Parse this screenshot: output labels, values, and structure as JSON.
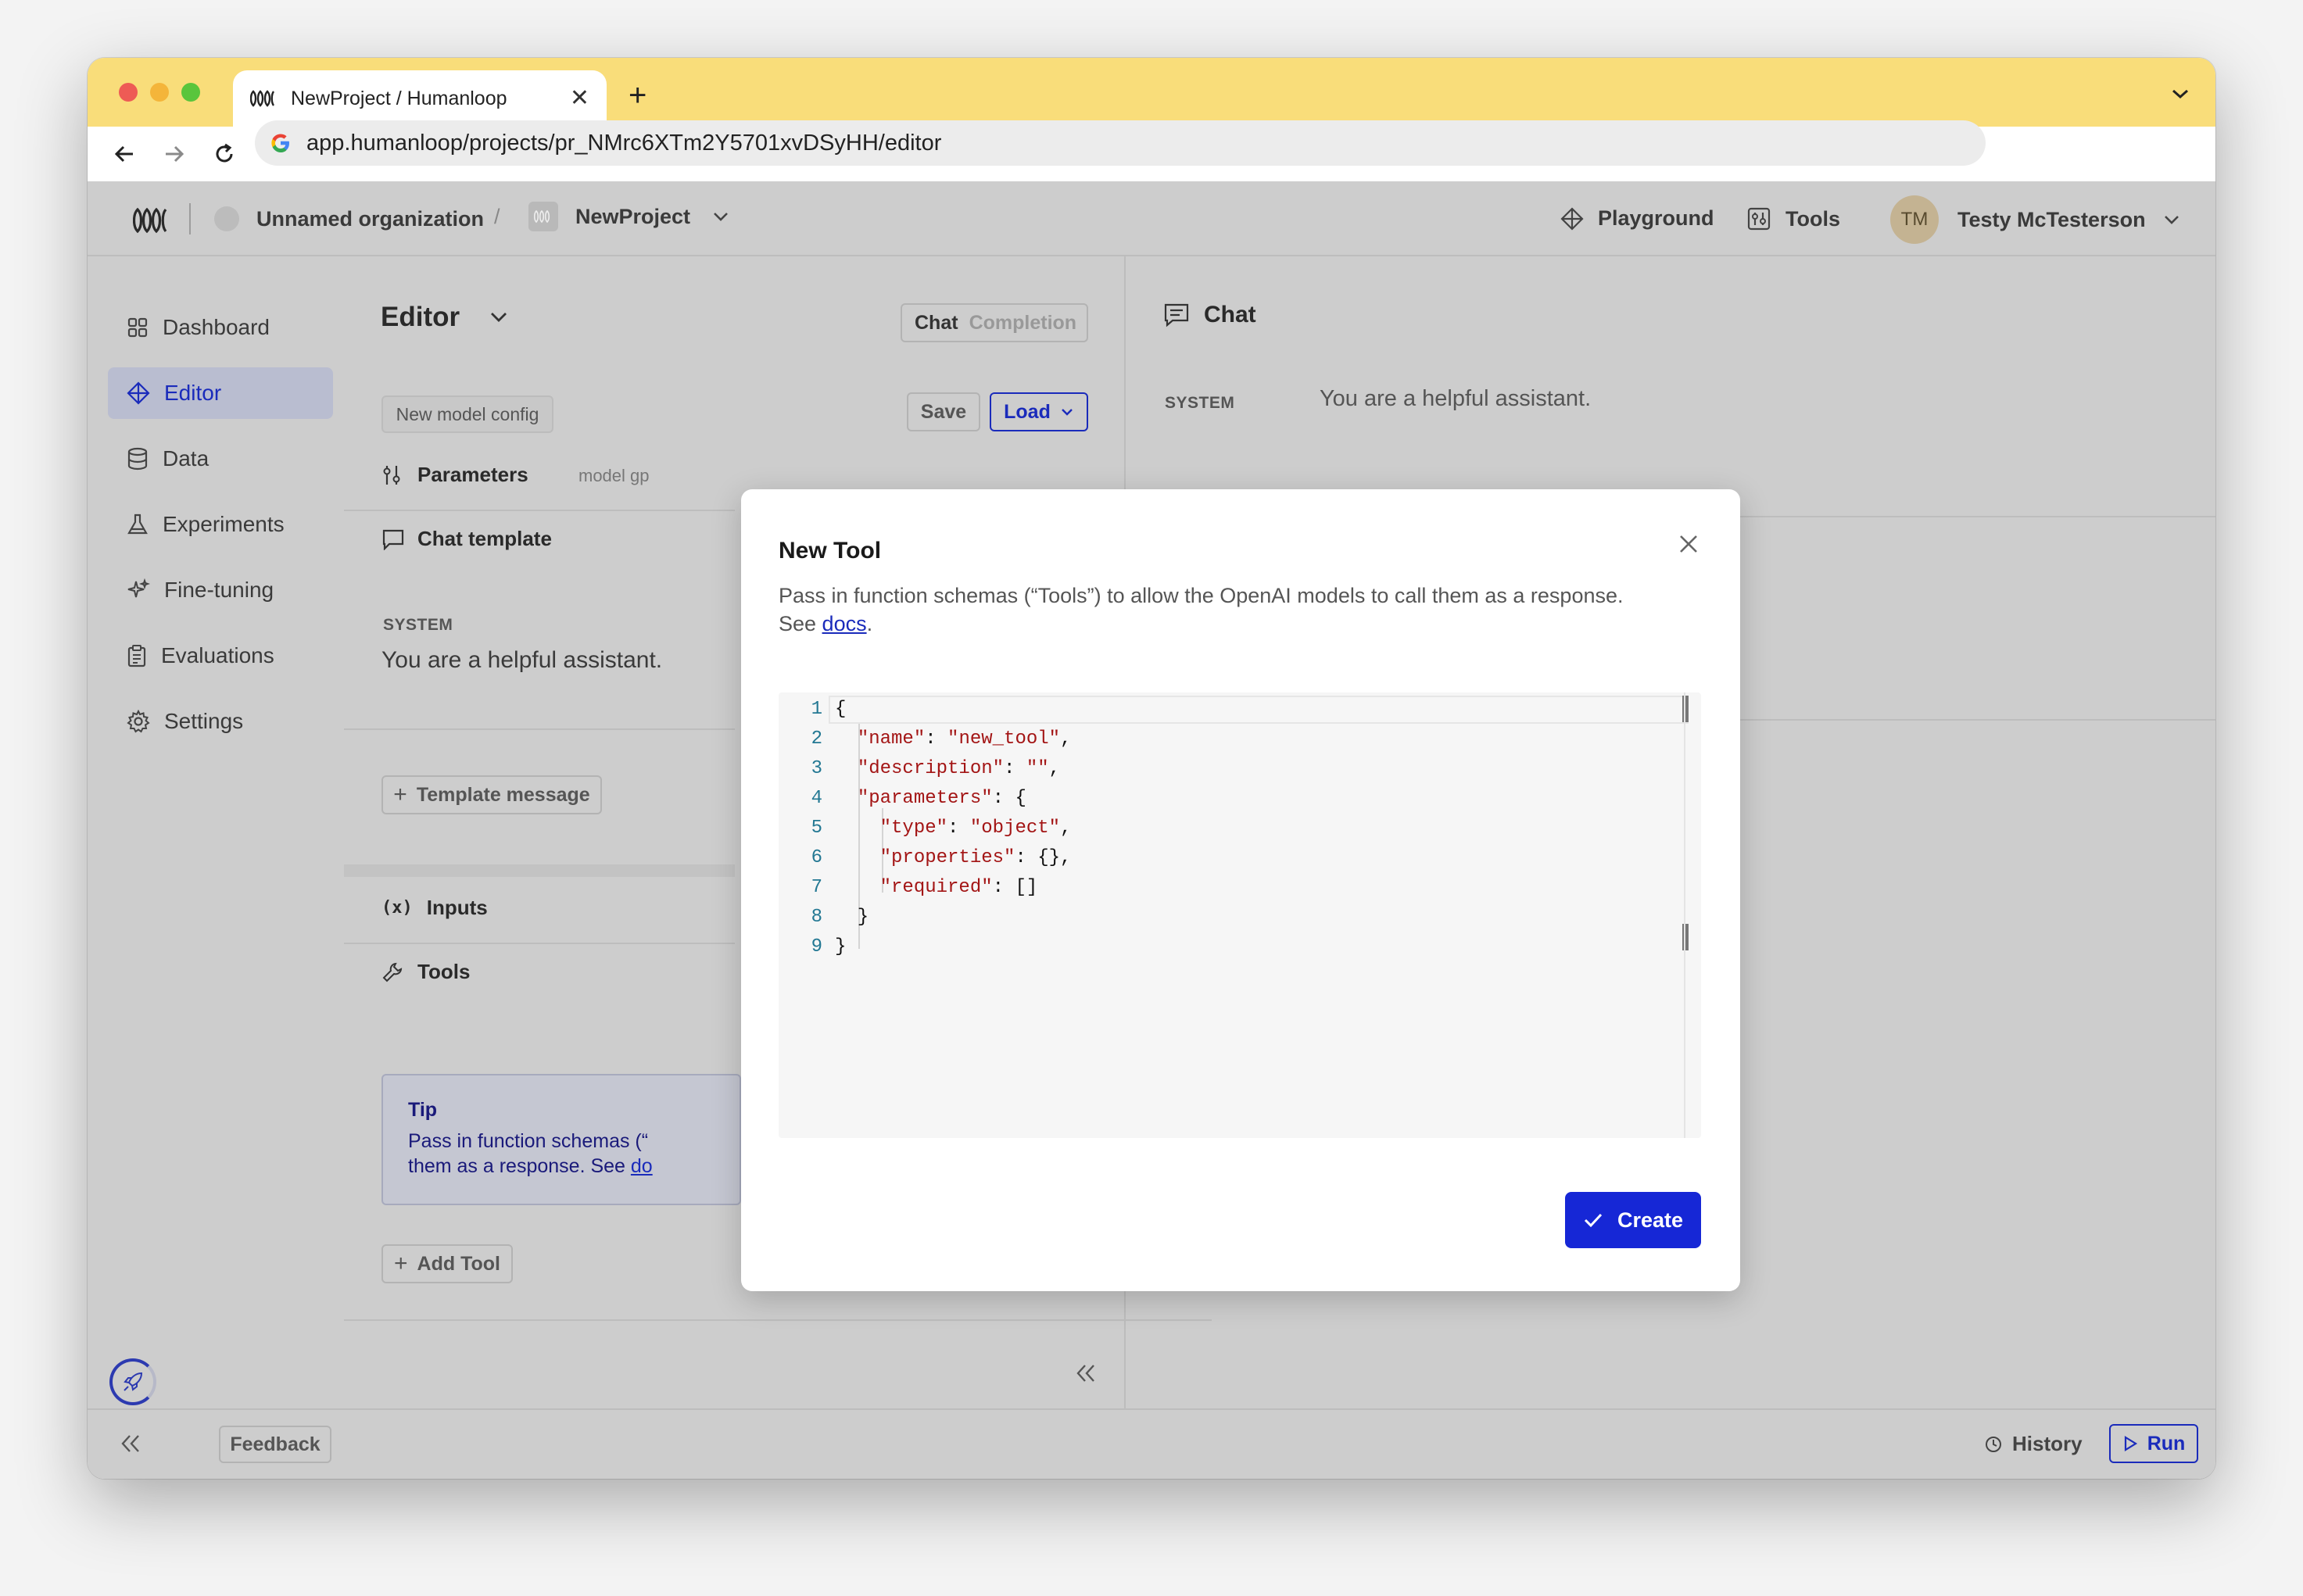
{
  "browser": {
    "tab_title": "NewProject / Humanloop",
    "url": "app.humanloop/projects/pr_NMrc6XTm2Y5701xvDSyHH/editor",
    "profile_initial": "G"
  },
  "header": {
    "org": "Unnamed organization",
    "separator": "/",
    "project": "NewProject",
    "playground": "Playground",
    "tools": "Tools",
    "user_initials": "TM",
    "user_name": "Testy McTesterson"
  },
  "sidebar": {
    "items": [
      {
        "label": "Dashboard",
        "icon": "grid-icon"
      },
      {
        "label": "Editor",
        "icon": "diamond-icon",
        "active": true
      },
      {
        "label": "Data",
        "icon": "database-icon"
      },
      {
        "label": "Experiments",
        "icon": "flask-icon"
      },
      {
        "label": "Fine-tuning",
        "icon": "sparkle-icon"
      },
      {
        "label": "Evaluations",
        "icon": "clipboard-icon"
      },
      {
        "label": "Settings",
        "icon": "gear-icon"
      }
    ]
  },
  "editor_panel": {
    "title": "Editor",
    "mode_chat": "Chat",
    "mode_completion": "Completion",
    "config_name": "New model config",
    "save": "Save",
    "load": "Load",
    "parameters": "Parameters",
    "parameters_hint": "model gp",
    "chat_template": "Chat template",
    "system_label": "SYSTEM",
    "system_text": "You are a helpful assistant.",
    "template_message": "Template message",
    "inputs": "Inputs",
    "tools": "Tools",
    "tip_title": "Tip",
    "tip_line1": "Pass in function schemas (“",
    "tip_line2_prefix": "them as a response. See ",
    "tip_link": "do",
    "add_tool": "Add Tool"
  },
  "chat_panel": {
    "title": "Chat",
    "system_label": "SYSTEM",
    "system_text": "You are a helpful assistant."
  },
  "footer": {
    "feedback": "Feedback",
    "history": "History",
    "run": "Run"
  },
  "modal": {
    "title": "New Tool",
    "desc_line1": "Pass in function schemas (“Tools”) to allow the OpenAI models to call them as a response.",
    "desc_see": "See ",
    "desc_link": "docs",
    "desc_end": ".",
    "create": "Create",
    "code_lines": [
      "{",
      "  \"name\": \"new_tool\",",
      "  \"description\": \"\",",
      "  \"parameters\": {",
      "    \"type\": \"object\",",
      "    \"properties\": {},",
      "    \"required\": []",
      "  }",
      "}"
    ],
    "line_numbers": [
      "1",
      "2",
      "3",
      "4",
      "5",
      "6",
      "7",
      "8",
      "9"
    ]
  },
  "colors": {
    "accent": "#1627d6",
    "tabbar": "#f9dd7a",
    "overlay_bg": "#cdcdcd"
  }
}
